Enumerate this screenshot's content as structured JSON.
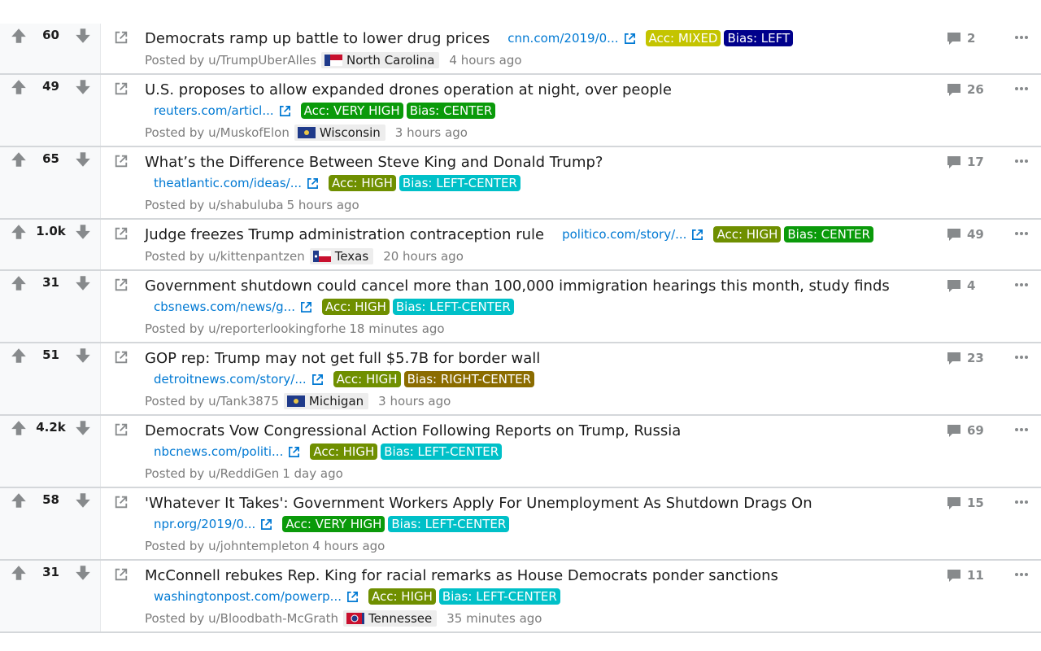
{
  "colors": {
    "acc_mixed": "#c4c400",
    "acc_very_high": "#0a9a0a",
    "acc_high": "#6f8f00",
    "bias_left": "#00008b",
    "bias_center": "#0a9a0a",
    "bias_left_center": "#00c0c8",
    "bias_right_center": "#8b6c00",
    "link": "#0079d3",
    "meta": "#7c7c7c"
  },
  "icons": {
    "upvote": "arrow-up-icon",
    "downvote": "arrow-down-icon",
    "external": "external-link-icon",
    "comment": "comment-bubble-icon",
    "more": "more-dots-icon"
  },
  "posts": [
    {
      "score": "60",
      "title": "Democrats ramp up battle to lower drug prices",
      "domain": "cnn.com/2019/0...",
      "acc": "Acc: MIXED",
      "acc_color": "#c4c400",
      "bias": "Bias: LEFT",
      "bias_color": "#00008b",
      "posted_by": "Posted by",
      "author": "u/TrumpUberAlles",
      "flair": "North Carolina",
      "flag": "nc",
      "time": "4 hours ago",
      "comments": "2",
      "layout": "inline"
    },
    {
      "score": "49",
      "title": "U.S. proposes to allow expanded drones operation at night, over people",
      "domain": "reuters.com/articl...",
      "acc": "Acc: VERY HIGH",
      "acc_color": "#0a9a0a",
      "bias": "Bias: CENTER",
      "bias_color": "#0a9a0a",
      "posted_by": "Posted by",
      "author": "u/MuskofElon",
      "flair": "Wisconsin",
      "flag": "wi",
      "time": "3 hours ago",
      "comments": "26",
      "layout": "block"
    },
    {
      "score": "65",
      "title": "What’s the Difference Between Steve King and Donald Trump?",
      "domain": "theatlantic.com/ideas/...",
      "acc": "Acc: HIGH",
      "acc_color": "#6f8f00",
      "bias": "Bias: LEFT-CENTER",
      "bias_color": "#00c0c8",
      "posted_by": "Posted by",
      "author": "u/shabuluba",
      "flair": "",
      "flag": "",
      "time": "5 hours ago",
      "comments": "17",
      "layout": "block"
    },
    {
      "score": "1.0k",
      "title": "Judge freezes Trump administration contraception rule",
      "domain": "politico.com/story/...",
      "acc": "Acc: HIGH",
      "acc_color": "#6f8f00",
      "bias": "Bias: CENTER",
      "bias_color": "#0a9a0a",
      "posted_by": "Posted by",
      "author": "u/kittenpantzen",
      "flair": "Texas",
      "flag": "tx",
      "time": "20 hours ago",
      "comments": "49",
      "layout": "inline"
    },
    {
      "score": "31",
      "title": "Government shutdown could cancel more than 100,000 immigration hearings this month, study finds",
      "domain": "cbsnews.com/news/g...",
      "acc": "Acc: HIGH",
      "acc_color": "#6f8f00",
      "bias": "Bias: LEFT-CENTER",
      "bias_color": "#00c0c8",
      "posted_by": "Posted by",
      "author": "u/reporterlookingforhe",
      "flair": "",
      "flag": "",
      "time": "18 minutes ago",
      "comments": "4",
      "layout": "block"
    },
    {
      "score": "51",
      "title": "GOP rep: Trump may not get full $5.7B for border wall",
      "domain": "detroitnews.com/story/...",
      "acc": "Acc: HIGH",
      "acc_color": "#6f8f00",
      "bias": "Bias: RIGHT-CENTER",
      "bias_color": "#8b6c00",
      "posted_by": "Posted by",
      "author": "u/Tank3875",
      "flair": "Michigan",
      "flag": "mi",
      "time": "3 hours ago",
      "comments": "23",
      "layout": "block"
    },
    {
      "score": "4.2k",
      "title": "Democrats Vow Congressional Action Following Reports on Trump, Russia",
      "domain": "nbcnews.com/politi...",
      "acc": "Acc: HIGH",
      "acc_color": "#6f8f00",
      "bias": "Bias: LEFT-CENTER",
      "bias_color": "#00c0c8",
      "posted_by": "Posted by",
      "author": "u/ReddiGen",
      "flair": "",
      "flag": "",
      "time": "1 day ago",
      "comments": "69",
      "layout": "block"
    },
    {
      "score": "58",
      "title": "'Whatever It Takes': Government Workers Apply For Unemployment As Shutdown Drags On",
      "domain": "npr.org/2019/0...",
      "acc": "Acc: VERY HIGH",
      "acc_color": "#0a9a0a",
      "bias": "Bias: LEFT-CENTER",
      "bias_color": "#00c0c8",
      "posted_by": "Posted by",
      "author": "u/johntempleton",
      "flair": "",
      "flag": "",
      "time": "4 hours ago",
      "comments": "15",
      "layout": "block"
    },
    {
      "score": "31",
      "title": "McConnell rebukes Rep. King for racial remarks as House Democrats ponder sanctions",
      "domain": "washingtonpost.com/powerp...",
      "acc": "Acc: HIGH",
      "acc_color": "#6f8f00",
      "bias": "Bias: LEFT-CENTER",
      "bias_color": "#00c0c8",
      "posted_by": "Posted by",
      "author": "u/Bloodbath-McGrath",
      "flair": "Tennessee",
      "flag": "tn",
      "time": "35 minutes ago",
      "comments": "11",
      "layout": "block"
    }
  ]
}
